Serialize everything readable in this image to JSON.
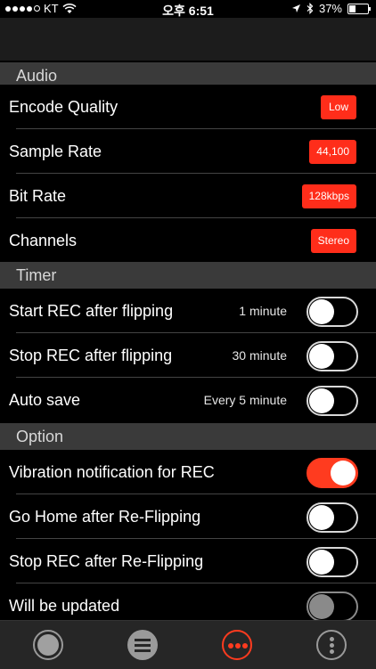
{
  "status_bar": {
    "carrier": "KT",
    "time": "오후 6:51",
    "battery": "37%",
    "battery_level": 0.37
  },
  "sections": {
    "audio": {
      "title": "Audio",
      "rows": [
        {
          "label": "Encode Quality",
          "value": "Low"
        },
        {
          "label": "Sample Rate",
          "value": "44,100"
        },
        {
          "label": "Bit Rate",
          "value": "128kbps"
        },
        {
          "label": "Channels",
          "value": "Stereo"
        }
      ]
    },
    "timer": {
      "title": "Timer",
      "rows": [
        {
          "label": "Start REC after flipping",
          "value": "1 minute",
          "on": false
        },
        {
          "label": "Stop REC after flipping",
          "value": "30 minute",
          "on": false
        },
        {
          "label": "Auto save",
          "value": "Every 5 minute",
          "on": false
        }
      ]
    },
    "option": {
      "title": "Option",
      "rows": [
        {
          "label": "Vibration notification for REC",
          "on": true
        },
        {
          "label": "Go Home after Re-Flipping",
          "on": false
        },
        {
          "label": "Stop REC after Re-Flipping",
          "on": false
        },
        {
          "label": "Will be updated",
          "on": false,
          "disabled": true
        }
      ]
    }
  },
  "colors": {
    "accent": "#ff3b1f",
    "section_bg": "#3a3a3a",
    "tabbar_bg": "#262626"
  },
  "tabbar": {
    "items": [
      {
        "icon": "record-icon"
      },
      {
        "icon": "list-icon"
      },
      {
        "icon": "settings-dots-icon",
        "active": true
      },
      {
        "icon": "more-vertical-icon"
      }
    ]
  }
}
